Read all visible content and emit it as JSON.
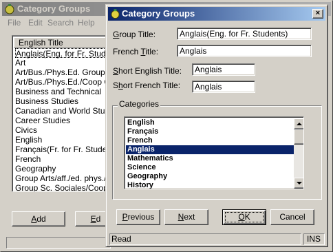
{
  "background_window": {
    "title": "Category Groups",
    "menu": [
      "File",
      "Edit",
      "Search",
      "Help"
    ],
    "list_header": "English Title",
    "list_rows": [
      "Anglais(Eng. for Fr. Students)",
      "Art",
      "Art/Bus./Phys.Ed. Group",
      "Art/Bus./Phys.Ed./Coop Group",
      "Business and Technical",
      "Business Studies",
      "Canadian and World Studies",
      "Career Studies",
      "Civics",
      "English",
      "Français(Fr. for Fr. Students)",
      "French",
      "Geography",
      "Group Arts/aff./ed. phys./Ed.",
      "Group Sc. Sociales/Coop/E"
    ],
    "add_label_u": "A",
    "add_label_rest": "dd",
    "edit_label_u": "E",
    "edit_label_rest": "d"
  },
  "dialog": {
    "title": "Category Groups",
    "close_glyph": "×",
    "group_title_label_u": "G",
    "group_title_label_rest": "roup Title:",
    "group_title_value": "Anglais(Eng. for Fr. Students)",
    "french_title_label_pre": "French ",
    "french_title_label_u": "T",
    "french_title_label_rest": "itle:",
    "french_title_value": "Anglais",
    "short_english_label_u": "S",
    "short_english_label_rest": "hort English Title:",
    "short_english_value": "Anglais",
    "short_french_label_pre": "S",
    "short_french_label_u": "h",
    "short_french_label_rest": "ort French Title:",
    "short_french_value": "Anglais",
    "categories_label": "Categories",
    "categories": [
      "English",
      "Français",
      "French",
      "Anglais",
      "Mathematics",
      "Science",
      "Geography",
      "History"
    ],
    "selected_category": "Anglais",
    "buttons": {
      "previous_u": "P",
      "previous_rest": "revious",
      "next_u": "N",
      "next_rest": "ext",
      "ok_u": "O",
      "ok_rest": "K",
      "cancel": "Cancel"
    },
    "status": "Read",
    "ins": "INS"
  }
}
